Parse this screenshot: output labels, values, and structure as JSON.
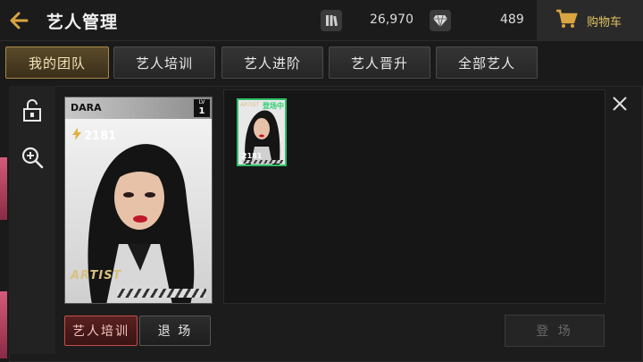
{
  "header": {
    "title": "艺人管理",
    "back_icon": "back-arrow-icon",
    "resources": [
      {
        "icon": "book-icon",
        "value": "26,970"
      },
      {
        "icon": "diamond-icon",
        "value": "489"
      }
    ],
    "cart": {
      "icon": "cart-icon",
      "label": "购物车"
    }
  },
  "tabs": [
    {
      "label": "我的团队",
      "active": true
    },
    {
      "label": "艺人培训",
      "active": false
    },
    {
      "label": "艺人进阶",
      "active": false
    },
    {
      "label": "艺人晋升",
      "active": false
    },
    {
      "label": "全部艺人",
      "active": false
    }
  ],
  "tools": [
    {
      "icon": "lock-icon"
    },
    {
      "icon": "zoom-in-icon"
    }
  ],
  "selected_card": {
    "name": "DARA",
    "lv_label": "LV",
    "level": "1",
    "power": "2181",
    "logo": "ARTIST"
  },
  "actions": {
    "train_label": "艺人培训",
    "leave_label": "退 场"
  },
  "roster": [
    {
      "logo": "ARTIST",
      "status": "登场中",
      "power": "2181"
    }
  ],
  "debut_label": "登 场",
  "colors": {
    "accent_gold": "#a8894a",
    "active_green": "#2fbf6a",
    "train_red": "#c0504a"
  }
}
